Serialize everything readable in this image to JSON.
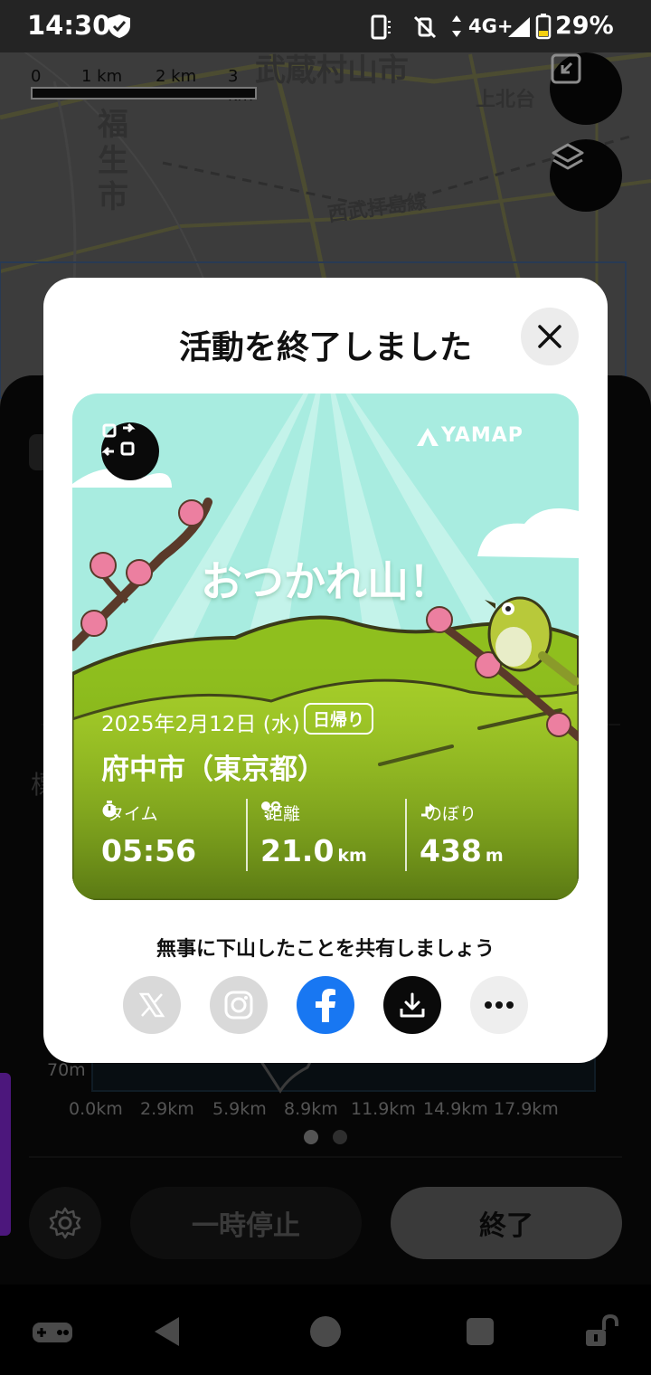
{
  "status_bar": {
    "time": "14:30",
    "network": "4G+",
    "battery": "29%"
  },
  "map": {
    "scale_labels": [
      "0",
      "1 km",
      "2 km",
      "3 km"
    ],
    "place_labels": [
      "武蔵村山市",
      "福生市",
      "西武拝島線",
      "上北台"
    ]
  },
  "panel": {
    "km_ticks": [
      "0.0km",
      "2.9km",
      "5.9km",
      "8.9km",
      "11.9km",
      "14.9km",
      "17.9km"
    ],
    "elevation_tick": "70m",
    "pause_label": "一時停止",
    "end_label": "終了"
  },
  "modal": {
    "title": "活動を終了しました",
    "card": {
      "brand": "YAMAP",
      "headline": "おつかれ山！",
      "date": "2025年2月12日 (水)",
      "trip_type": "日帰り",
      "location": "府中市（東京都）",
      "stats": [
        {
          "label": "タイム",
          "value": "05:56",
          "unit": ""
        },
        {
          "label": "距離",
          "value": "21.0",
          "unit": "km"
        },
        {
          "label": "のぼり",
          "value": "438",
          "unit": "m"
        }
      ]
    },
    "share_prompt": "無事に下山したことを共有しましょう",
    "share_targets": [
      "x-icon",
      "instagram-icon",
      "facebook-icon",
      "download-icon",
      "more-icon"
    ],
    "colors": {
      "facebook": "#1877f2",
      "card_sky": "#a8ece0",
      "card_grass": "#8fbf1e"
    }
  }
}
